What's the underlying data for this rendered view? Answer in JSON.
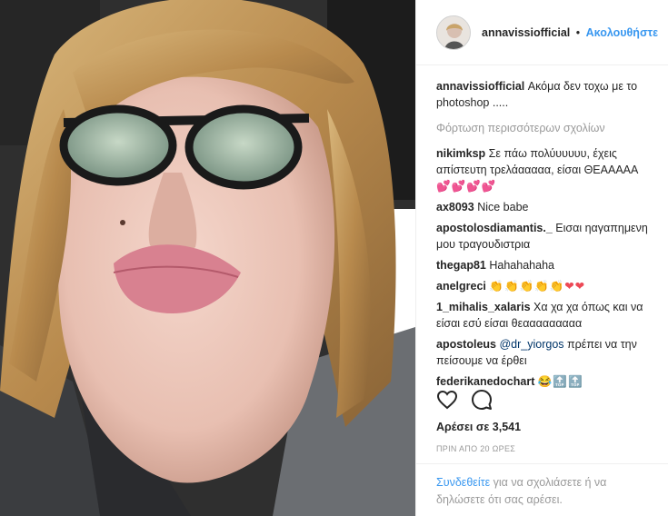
{
  "post": {
    "username": "annavissiofficial",
    "separator": "•",
    "follow_label": "Ακολουθήστε",
    "caption_user": "annavissiofficial",
    "caption_text": "Ακόμα δεν τοχω με το photoshop .....",
    "load_more": "Φόρτωση περισσότερων σχολίων"
  },
  "comments": [
    {
      "user": "nikimksp",
      "text": "Σε πάω πολύυυυυυ, έχεις απίστευτη τρελάααααα, είσαι ΘΕΑΑΑΑΑ",
      "emoji": "💕💕💕💕"
    },
    {
      "user": "ax8093",
      "text": "Nice babe",
      "emoji": ""
    },
    {
      "user": "apostolosdiamantis._",
      "text": "Εισαι ηαγαπημενη μου τραγουδιστρια",
      "emoji": ""
    },
    {
      "user": "thegap81",
      "text": "Hahahahaha",
      "emoji": ""
    },
    {
      "user": "anelgreci",
      "text": "",
      "emoji": "👏👏👏👏👏❤❤"
    },
    {
      "user": "1_mihalis_xalaris",
      "text": "Χα χα χα όπως και να είσαι εσύ είσαι θεααααααααα",
      "emoji": ""
    },
    {
      "user": "apostoleus",
      "mention": "@dr_yiorgos",
      "text": "πρέπει να την πείσουμε να έρθει",
      "emoji": ""
    },
    {
      "user": "federikanedochart",
      "text": "",
      "emoji": "😂🔝🔝"
    }
  ],
  "footer": {
    "likes": "Αρέσει σε 3,541",
    "time": "ΠΡΙΝ ΑΠΟ 20 ΩΡΕΣ",
    "login_link": "Συνδεθείτε",
    "login_text": "για να σχολιάσετε ή να δηλώσετε ότι σας αρέσει."
  },
  "icons": {
    "like": "heart-icon",
    "comment": "comment-icon"
  },
  "colors": {
    "link": "#3897f0",
    "muted": "#999999",
    "text": "#262626"
  }
}
